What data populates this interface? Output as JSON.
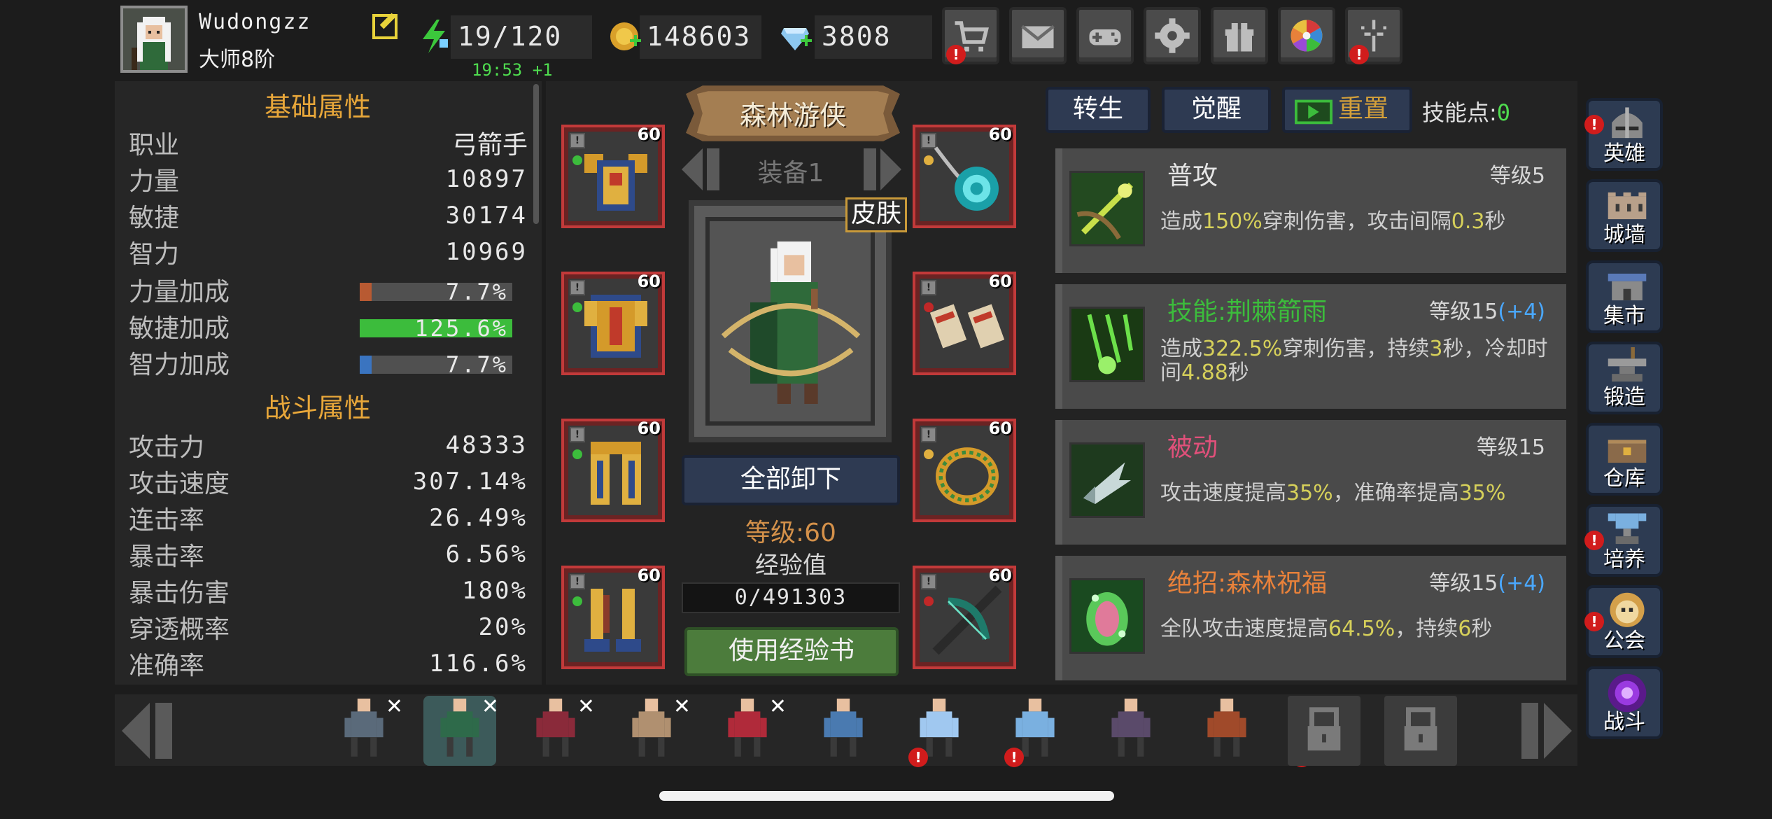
{
  "player": {
    "name": "Wudongzz",
    "rank": "大师8阶"
  },
  "resources": {
    "energy": "19/120",
    "energy_timer": "19:53 +1",
    "gold": "148603",
    "diamonds": "3808"
  },
  "top_menu": [
    {
      "name": "shop-icon",
      "alert": "!"
    },
    {
      "name": "mail-icon",
      "alert": ""
    },
    {
      "name": "gamepad-icon",
      "alert": ""
    },
    {
      "name": "settings-gear-icon",
      "alert": ""
    },
    {
      "name": "gift-icon",
      "alert": ""
    },
    {
      "name": "lucky-wheel-icon",
      "alert": ""
    },
    {
      "name": "fireworks-icon",
      "alert": "!"
    }
  ],
  "basic_attributes": {
    "title": "基础属性",
    "rows": [
      {
        "label": "职业",
        "value": "弓箭手"
      },
      {
        "label": "力量",
        "value": "10897"
      },
      {
        "label": "敏捷",
        "value": "30174"
      },
      {
        "label": "智力",
        "value": "10969"
      }
    ],
    "bonuses": [
      {
        "label": "力量加成",
        "value": "7.7%",
        "percent": 7.7,
        "color": "#b85a32"
      },
      {
        "label": "敏捷加成",
        "value": "125.6%",
        "percent": 100,
        "color": "#3cbc3c"
      },
      {
        "label": "智力加成",
        "value": "7.7%",
        "percent": 7.7,
        "color": "#3a74c0"
      }
    ]
  },
  "combat_attributes": {
    "title": "战斗属性",
    "rows": [
      {
        "label": "攻击力",
        "value": "48333"
      },
      {
        "label": "攻击速度",
        "value": "307.14%"
      },
      {
        "label": "连击率",
        "value": "26.49%"
      },
      {
        "label": "暴击率",
        "value": "6.56%"
      },
      {
        "label": "暴击伤害",
        "value": "180%"
      },
      {
        "label": "穿透概率",
        "value": "20%"
      },
      {
        "label": "准确率",
        "value": "116.6%"
      }
    ]
  },
  "equipment": {
    "hero_class": "森林游侠",
    "set_name": "装备1",
    "skin_label": "皮肤",
    "unequip_all": "全部卸下",
    "level_text": "等级:60",
    "exp_label": "经验值",
    "exp_value": "0/491303",
    "exp_fraction": 0,
    "use_exp_book": "使用经验书",
    "slots": [
      {
        "name": "armor-slot",
        "level": "60",
        "lock": "!",
        "gem": "#3cbc3c"
      },
      {
        "name": "amulet-slot",
        "level": "60",
        "lock": "!",
        "gem": "#e0b040"
      },
      {
        "name": "chest-slot",
        "level": "60",
        "lock": "!",
        "gem": "#3cbc3c"
      },
      {
        "name": "bracers-slot",
        "level": "60",
        "lock": "!",
        "gem": "#c02828"
      },
      {
        "name": "legs-slot",
        "level": "60",
        "lock": "!",
        "gem": "#3cbc3c"
      },
      {
        "name": "ring-slot",
        "level": "60",
        "lock": "!",
        "gem": "#e0b040"
      },
      {
        "name": "boots-slot",
        "level": "60",
        "lock": "!",
        "gem": "#3cbc3c"
      },
      {
        "name": "crossbow-slot",
        "level": "60",
        "lock": "!",
        "gem": "#c02828"
      }
    ]
  },
  "skills": {
    "tabs": {
      "rebirth": "转生",
      "awaken": "觉醒",
      "reset": "重置"
    },
    "skill_points_label": "技能点:",
    "skill_points": "0",
    "list": [
      {
        "name": "普攻",
        "name_color": "#e6e6e6",
        "level": "等级5",
        "bonus": "",
        "desc": [
          {
            "t": "造成",
            "h": false
          },
          {
            "t": "150%",
            "h": true
          },
          {
            "t": "穿刺伤害，攻击间隔",
            "h": false
          },
          {
            "t": "0.3",
            "h": true
          },
          {
            "t": "秒",
            "h": false
          }
        ]
      },
      {
        "name": "技能:荆棘箭雨",
        "name_color": "#3cbc3c",
        "level": "等级15",
        "bonus": "(+4)",
        "desc": [
          {
            "t": "造成",
            "h": false
          },
          {
            "t": "322.5%",
            "h": true
          },
          {
            "t": "穿刺伤害，持续",
            "h": false
          },
          {
            "t": "3",
            "h": true
          },
          {
            "t": "秒，冷却时间",
            "h": false
          },
          {
            "t": "4.88",
            "h": true
          },
          {
            "t": "秒",
            "h": false
          }
        ]
      },
      {
        "name": "被动",
        "name_color": "#e0507a",
        "level": "等级15",
        "bonus": "",
        "desc": [
          {
            "t": "攻击速度提高",
            "h": false
          },
          {
            "t": "35%",
            "h": true
          },
          {
            "t": "，准确率提高",
            "h": false
          },
          {
            "t": "35%",
            "h": true
          }
        ]
      },
      {
        "name": "绝招:森林祝福",
        "name_color": "#e8813a",
        "level": "等级15",
        "bonus": "(+4)",
        "desc": [
          {
            "t": "全队攻击速度提高",
            "h": false
          },
          {
            "t": "64.5%",
            "h": true
          },
          {
            "t": "，持续",
            "h": false
          },
          {
            "t": "6",
            "h": true
          },
          {
            "t": "秒",
            "h": false
          }
        ]
      }
    ]
  },
  "side_menu": [
    {
      "label": "英雄",
      "icon": "helmet-icon",
      "alert": true
    },
    {
      "label": "城墙",
      "icon": "castle-wall-icon",
      "alert": false
    },
    {
      "label": "集市",
      "icon": "market-icon",
      "alert": false
    },
    {
      "label": "锻造",
      "icon": "anvil-icon",
      "alert": false
    },
    {
      "label": "仓库",
      "icon": "warehouse-icon",
      "alert": false
    },
    {
      "label": "培养",
      "icon": "trophy-icon",
      "alert": true
    },
    {
      "label": "公会",
      "icon": "guild-lion-icon",
      "alert": true
    },
    {
      "label": "战斗",
      "icon": "portal-icon",
      "alert": false
    }
  ],
  "roster": [
    {
      "name": "roster-hero-swordsman",
      "x": true,
      "alert": false,
      "selected": false,
      "color": "#5a6a7a"
    },
    {
      "name": "roster-hero-ranger",
      "x": true,
      "alert": false,
      "selected": true,
      "color": "#2e6a4a"
    },
    {
      "name": "roster-hero-mage-red",
      "x": true,
      "alert": false,
      "selected": false,
      "color": "#8a2a3a"
    },
    {
      "name": "roster-hero-amazon",
      "x": true,
      "alert": false,
      "selected": false,
      "color": "#b09070"
    },
    {
      "name": "roster-hero-assassin",
      "x": true,
      "alert": false,
      "selected": false,
      "color": "#b02a3a"
    },
    {
      "name": "roster-hero-gunner",
      "x": false,
      "alert": false,
      "selected": false,
      "color": "#4a7ab0"
    },
    {
      "name": "roster-hero-ice-mage",
      "x": false,
      "alert": true,
      "selected": false,
      "color": "#a0c8f0"
    },
    {
      "name": "roster-hero-frost-spirit",
      "x": false,
      "alert": true,
      "selected": false,
      "color": "#7ab0e0"
    },
    {
      "name": "roster-hero-warlock",
      "x": false,
      "alert": false,
      "selected": false,
      "color": "#5a4a6a"
    },
    {
      "name": "roster-hero-demon-hunter",
      "x": false,
      "alert": false,
      "selected": false,
      "color": "#a04a2a"
    },
    {
      "name": "roster-hero-dark-knight",
      "x": false,
      "alert": true,
      "selected": false,
      "color": "#4a3a5a"
    }
  ]
}
